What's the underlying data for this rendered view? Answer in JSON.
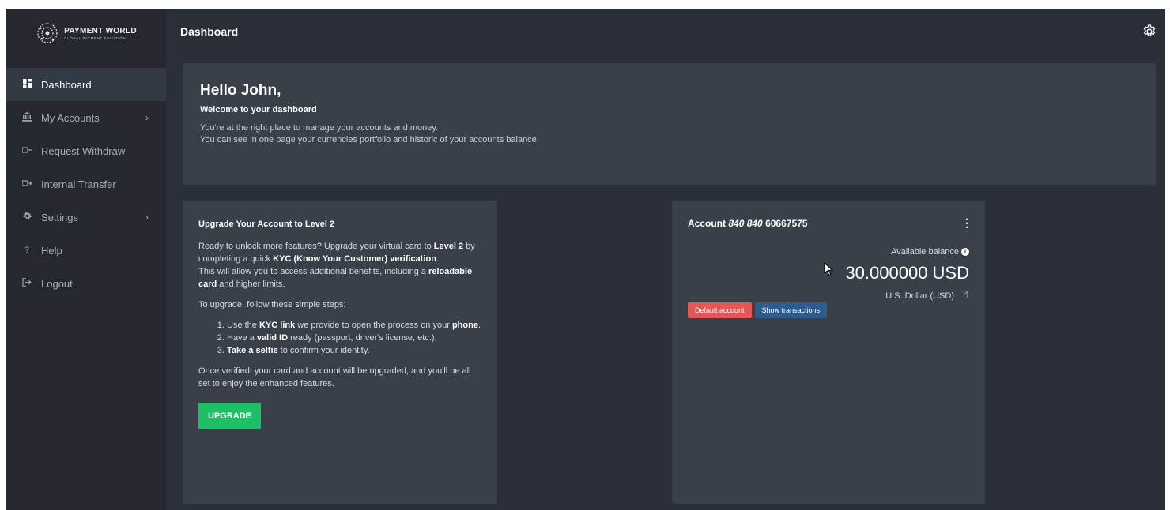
{
  "brand": {
    "name": "PAYMENT WORLD",
    "tagline": "GLOBAL PAYMENT SOLUTION"
  },
  "sidebar": {
    "items": [
      {
        "label": "Dashboard",
        "icon": "dashboard-icon",
        "active": true
      },
      {
        "label": "My Accounts",
        "icon": "bank-icon",
        "chevron": true
      },
      {
        "label": "Request Withdraw",
        "icon": "withdraw-icon"
      },
      {
        "label": "Internal Transfer",
        "icon": "transfer-icon"
      },
      {
        "label": "Settings",
        "icon": "gear-icon",
        "chevron": true
      },
      {
        "label": "Help",
        "icon": "help-icon"
      },
      {
        "label": "Logout",
        "icon": "logout-icon"
      }
    ]
  },
  "header": {
    "title": "Dashboard",
    "settings_icon": "gear-icon"
  },
  "welcome": {
    "greeting": "Hello John,",
    "subtitle": "Welcome to your dashboard",
    "line1": "You're at the right place to manage your accounts and money.",
    "line2": "You can see in one page your currencies portfolio and historic of your accounts balance."
  },
  "upgrade_card": {
    "title": "Upgrade Your Account to Level 2",
    "p1_a": "Ready to unlock more features? Upgrade your virtual card to ",
    "p1_b": "Level 2",
    "p1_c": " by completing a quick ",
    "p1_d": "KYC (Know Your Customer) verification",
    "p1_e": ".",
    "p2_a": "This will allow you to access additional benefits, including a ",
    "p2_b": "reloadable card",
    "p2_c": " and higher limits.",
    "steps_intro": "To upgrade, follow these simple steps:",
    "step1_a": "Use the ",
    "step1_b": "KYC link",
    "step1_c": " we provide to open the process on your ",
    "step1_d": "phone",
    "step1_e": ".",
    "step2_a": "Have a ",
    "step2_b": "valid ID",
    "step2_c": " ready (passport, driver's license, etc.).",
    "step3_a": "Take a selfie",
    "step3_b": " to confirm your identity.",
    "outro": "Once verified, your card and account will be upgraded, and you'll be all set to enjoy the enhanced features.",
    "button": "UPGRADE"
  },
  "account_card": {
    "title_prefix": "Account ",
    "title_italic": "840 840",
    "title_number": " 60667575",
    "available_label": "Available balance",
    "balance": "30.000000 USD",
    "currency": "U.S. Dollar (USD)",
    "default_badge": "Default account",
    "transactions_button": "Show transactions"
  },
  "colors": {
    "app_bg": "#2b3038",
    "sidebar_bg": "#25292f",
    "card_bg": "#3a4049",
    "upgrade_green": "#1fbf67",
    "default_red": "#e25757",
    "transactions_blue": "#2f5c8d"
  }
}
